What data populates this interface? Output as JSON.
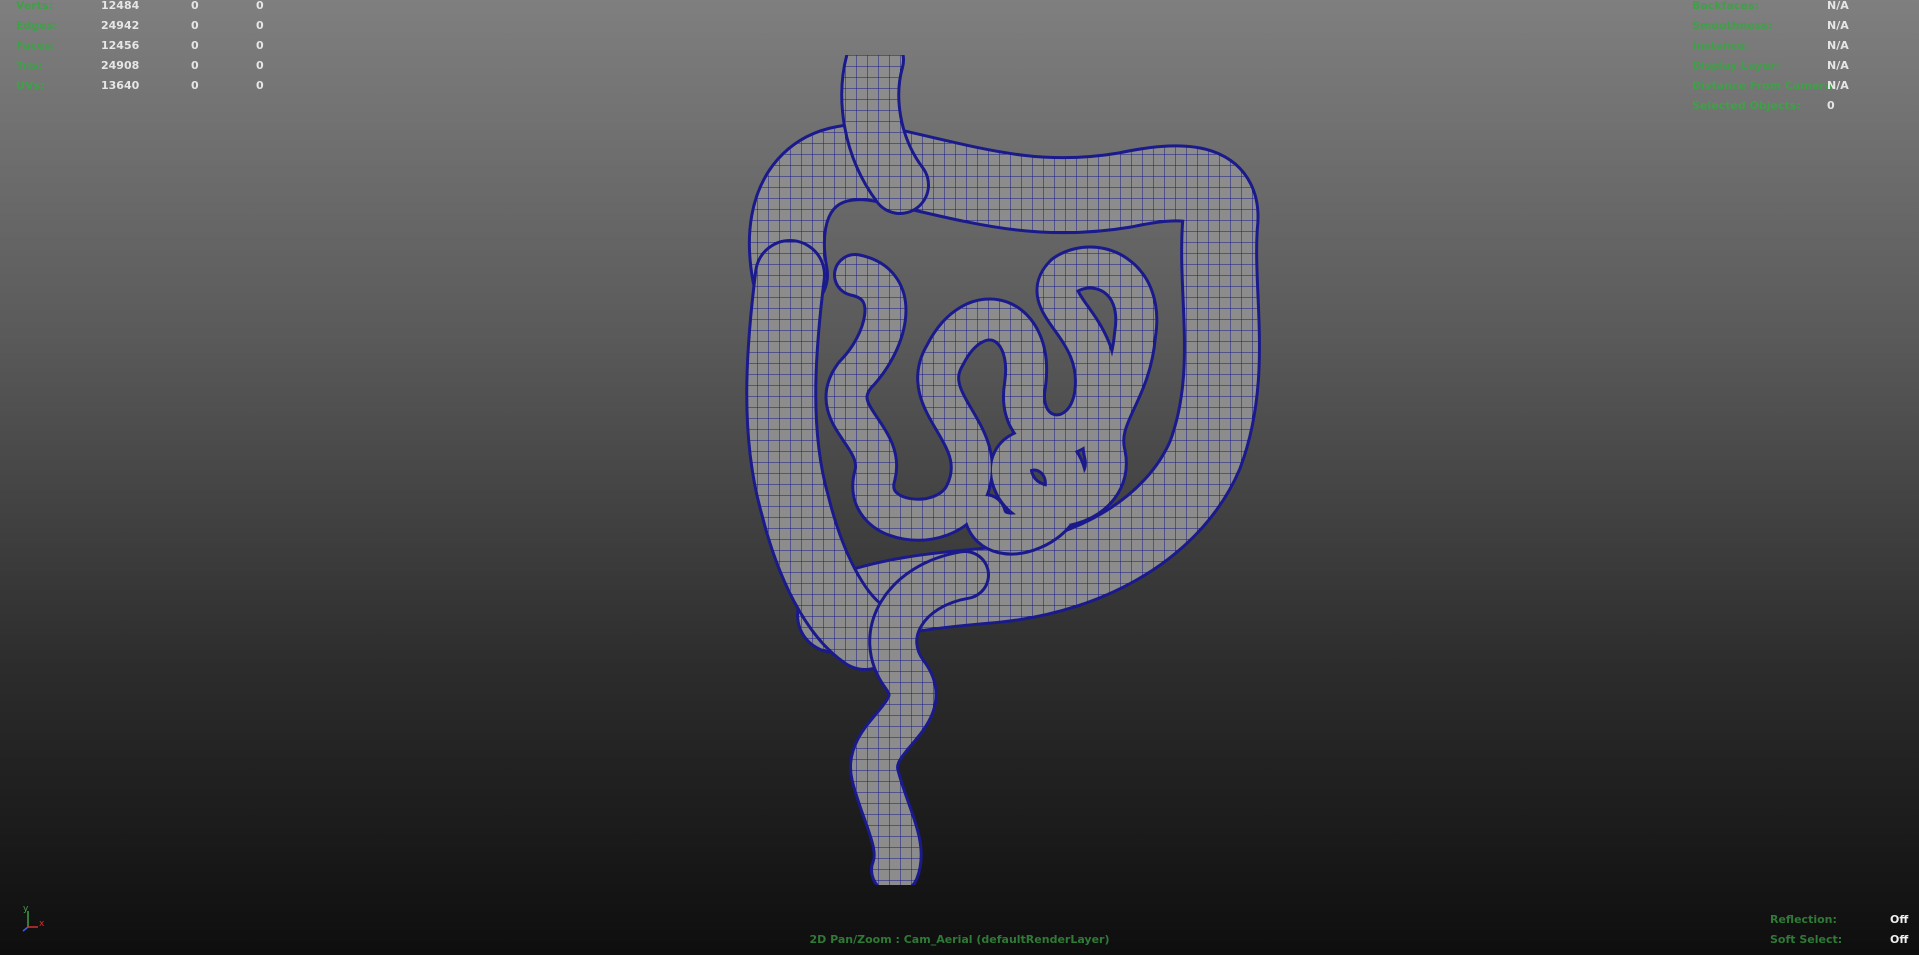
{
  "stats": [
    {
      "label": "Verts:",
      "values": [
        "12484",
        "0",
        "0"
      ]
    },
    {
      "label": "Edges:",
      "values": [
        "24942",
        "0",
        "0"
      ]
    },
    {
      "label": "Faces:",
      "values": [
        "12456",
        "0",
        "0"
      ]
    },
    {
      "label": "Tris:",
      "values": [
        "24908",
        "0",
        "0"
      ]
    },
    {
      "label": "UVs:",
      "values": [
        "13640",
        "0",
        "0"
      ]
    }
  ],
  "object_info": [
    {
      "label": "Backfaces:",
      "value": "N/A"
    },
    {
      "label": "Smoothness:",
      "value": "N/A"
    },
    {
      "label": "Instance:",
      "value": "N/A"
    },
    {
      "label": "Display Layer:",
      "value": "N/A"
    },
    {
      "label": "Distance From Camera:",
      "value": "N/A"
    },
    {
      "label": "Selected Objects:",
      "value": "0"
    }
  ],
  "camera_label": "2D Pan/Zoom : Cam_Aerial (defaultRenderLayer)",
  "toggles": [
    {
      "label": "Reflection:",
      "value": "Off"
    },
    {
      "label": "Soft Select:",
      "value": "Off"
    }
  ],
  "axis": {
    "y": "y",
    "x": "x"
  },
  "colors": {
    "label_green": "#3fa048",
    "wire_blue": "#1a1a8c",
    "mesh_gray": "#8a8a8a"
  }
}
